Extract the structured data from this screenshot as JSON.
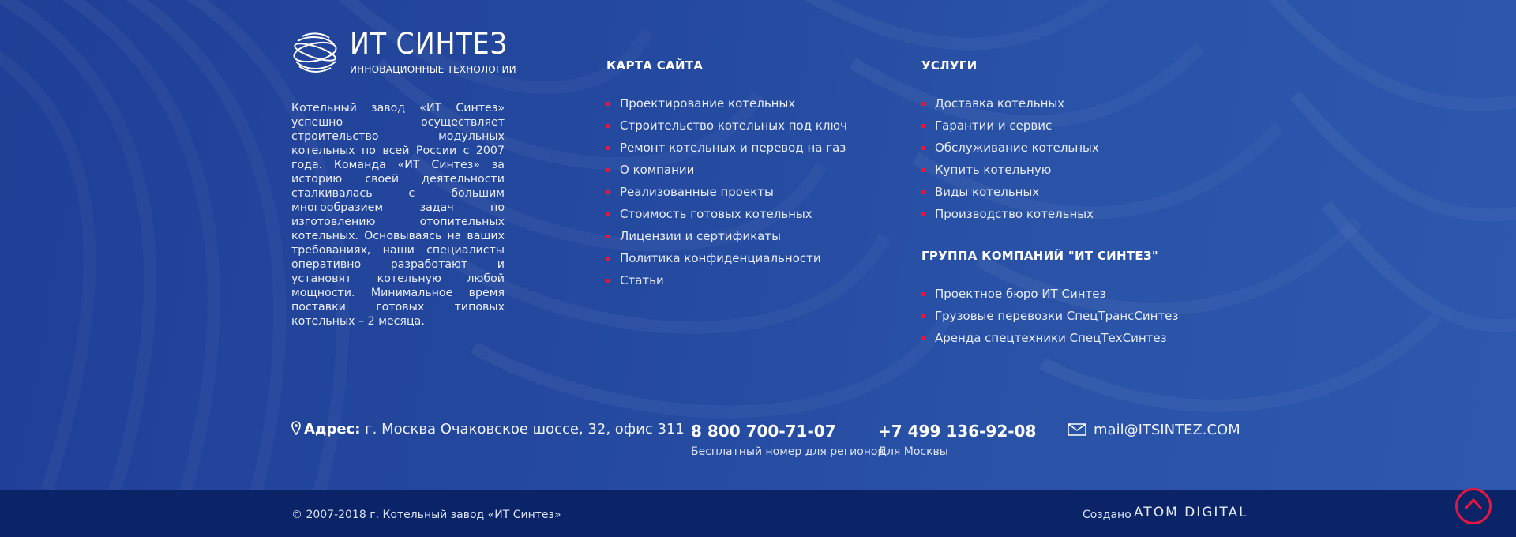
{
  "logo": {
    "title": "ИТ СИНТЕЗ",
    "subtitle": "ИННОВАЦИОННЫЕ ТЕХНОЛОГИИ"
  },
  "about": "Котельный завод «ИТ Синтез» успешно осуществляет строительство модульных котельных по всей России с 2007 года. Команда «ИТ Синтез» за историю своей деятельности сталкивалась с большим многообразием задач по изготовлению отопительных котельных. Основываясь на ваших требованиях, наши специалисты оперативно разработают и установят котельную любой мощности. Минимальное время поставки готовых типовых котельных – 2 месяца.",
  "sitemap": {
    "title": "КАРТА САЙТА",
    "items": [
      "Проектирование котельных",
      "Строительство котельных под ключ",
      "Ремонт котельных и перевод на газ",
      "О компании",
      "Реализованные проекты",
      "Стоимость готовых котельных",
      "Лицензии и сертификаты",
      "Политика конфиденциальности",
      "Статьи"
    ]
  },
  "services": {
    "title": "УСЛУГИ",
    "items": [
      "Доставка котельных",
      "Гарантии и сервис",
      "Обслуживание котельных",
      "Купить котельную",
      "Виды котельных",
      "Производство котельных"
    ]
  },
  "group": {
    "title": "ГРУППА КОМПАНИЙ \"ИТ СИНТЕЗ\"",
    "items": [
      "Проектное бюро ИТ Синтез",
      "Грузовые перевозки СпецТрансСинтез",
      "Аренда спецтехники СпецТехСинтез"
    ]
  },
  "contacts": {
    "address_label": "Адрес:",
    "address": "г. Москва Очаковское шоссе, 32, офис 311",
    "phone1": "8 800 700-71-07",
    "phone1_note": "Бесплатный номер для регионов",
    "phone2": "+7 499 136-92-08",
    "phone2_note": "Для Москвы",
    "email": "mail@ITSINTEZ.COM"
  },
  "footer": {
    "copyright": "© 2007-2018 г. Котельный завод «ИТ Синтез»",
    "created_label": "Создано",
    "created_by": "ATOM DIGITAL"
  },
  "icons": {
    "address": "map-pin-icon",
    "email": "envelope-icon",
    "scroll_top": "chevron-up-icon"
  },
  "colors": {
    "background": "#2448a0",
    "bottom_bar": "#0a2467",
    "accent": "#e3173f"
  }
}
